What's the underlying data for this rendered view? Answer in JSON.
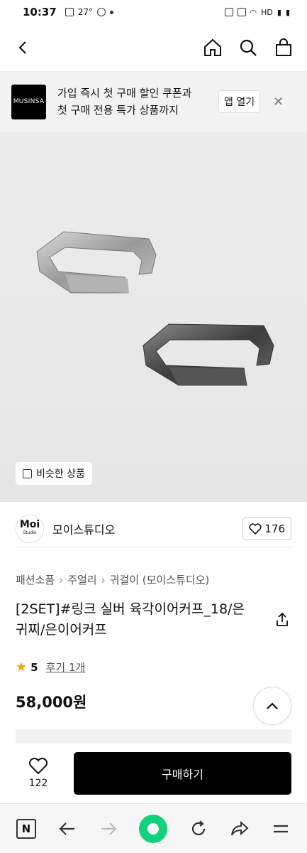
{
  "status_bar": {
    "time": "10:37",
    "temp": "27°",
    "network": "HD"
  },
  "promo": {
    "logo_text": "MUSINSA",
    "line1": "가입 즉시 첫 구매 할인 쿠폰과",
    "line2": "첫 구매 전용 특가 상품까지",
    "open_app_label": "앱 열기"
  },
  "image": {
    "similar_label": "비슷한 상품"
  },
  "brand": {
    "logo_main": "Moi",
    "logo_sub": "Studio",
    "name": "모이스튜디오",
    "likes": "176"
  },
  "breadcrumb": [
    "패션소품",
    "주얼리",
    "귀걸이 (모이스튜디오)"
  ],
  "product": {
    "title": "[2SET]#링크 실버 육각이어커프_18/은귀찌/은이어커프",
    "rating": "5",
    "reviews": "후기 1개",
    "price": "58,000원"
  },
  "buy_bar": {
    "fav_count": "122",
    "buy_label": "구매하기"
  },
  "colors": {
    "accent_star": "#f4a300",
    "buy_button": "#000000",
    "browser_green": "#11d17a"
  }
}
